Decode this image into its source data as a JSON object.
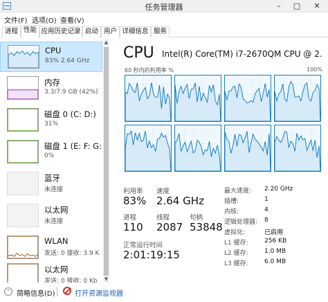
{
  "window": {
    "title": "任务管理器",
    "minimize": "–",
    "maximize": "□",
    "close": "✕"
  },
  "menu": [
    "文件(F)",
    "选项(O)",
    "查看(V)"
  ],
  "tabs": [
    "进程",
    "性能",
    "应用历史记录",
    "启动",
    "用户",
    "详细信息",
    "服务"
  ],
  "active_tab": "性能",
  "sidebar": {
    "items": [
      {
        "name": "CPU",
        "sub": "83% 2.64 GHz",
        "color": "#117dbb",
        "selected": true
      },
      {
        "name": "内存",
        "sub": "3.3/7.9 GB (42%)",
        "color": "#8b12ae",
        "selected": false
      },
      {
        "name": "磁盘 0 (C: D:)",
        "sub": "31%",
        "color": "#4da60c",
        "selected": false
      },
      {
        "name": "磁盘 1 (E: F: G:",
        "sub": "0%",
        "color": "#4da60c",
        "selected": false
      },
      {
        "name": "蓝牙",
        "sub": "未连接",
        "color": "#aaaaaa",
        "selected": false
      },
      {
        "name": "以太网",
        "sub": "未连接",
        "color": "#aaaaaa",
        "selected": false
      },
      {
        "name": "WLAN",
        "sub": "发送: 0 接收: 3.9 K",
        "color": "#a74f01",
        "selected": false
      },
      {
        "name": "以太网",
        "sub": "发送: 0 接收: 0 Kb",
        "color": "#a74f01",
        "selected": false
      }
    ],
    "scroll_up": "▲",
    "scroll_down": "▼"
  },
  "cpu": {
    "title": "CPU",
    "model": "Intel(R) Core(TM) i7-2670QM CPU @ 2.",
    "graph_caption": "60 秒内的利用率 %",
    "graph_max": "100%",
    "core_color": "#117dbb",
    "core_fill": "#d7eaf7",
    "stats": {
      "utilization_label": "利用率",
      "utilization": "83%",
      "speed_label": "速度",
      "speed": "2.64 GHz",
      "processes_label": "进程",
      "processes": "110",
      "threads_label": "线程",
      "threads": "2087",
      "handles_label": "句柄",
      "handles": "53848",
      "uptime_label": "正常运行时间",
      "uptime": "2:01:19:15"
    },
    "details": [
      {
        "label": "最大速度:",
        "value": "2.20 GHz"
      },
      {
        "label": "插槽:",
        "value": "1"
      },
      {
        "label": "内核:",
        "value": "4"
      },
      {
        "label": "逻辑处理器:",
        "value": "8"
      },
      {
        "label": "虚拟化:",
        "value": "已启用"
      },
      {
        "label": "L1 缓存:",
        "value": "256 KB"
      },
      {
        "label": "L2 缓存:",
        "value": "1.0 MB"
      },
      {
        "label": "L3 缓存:",
        "value": "6.0 MB"
      }
    ]
  },
  "footer": {
    "toggle": "⌃",
    "fewer_details": "简略信息(D)",
    "open_resmon": "打开资源监视器"
  }
}
